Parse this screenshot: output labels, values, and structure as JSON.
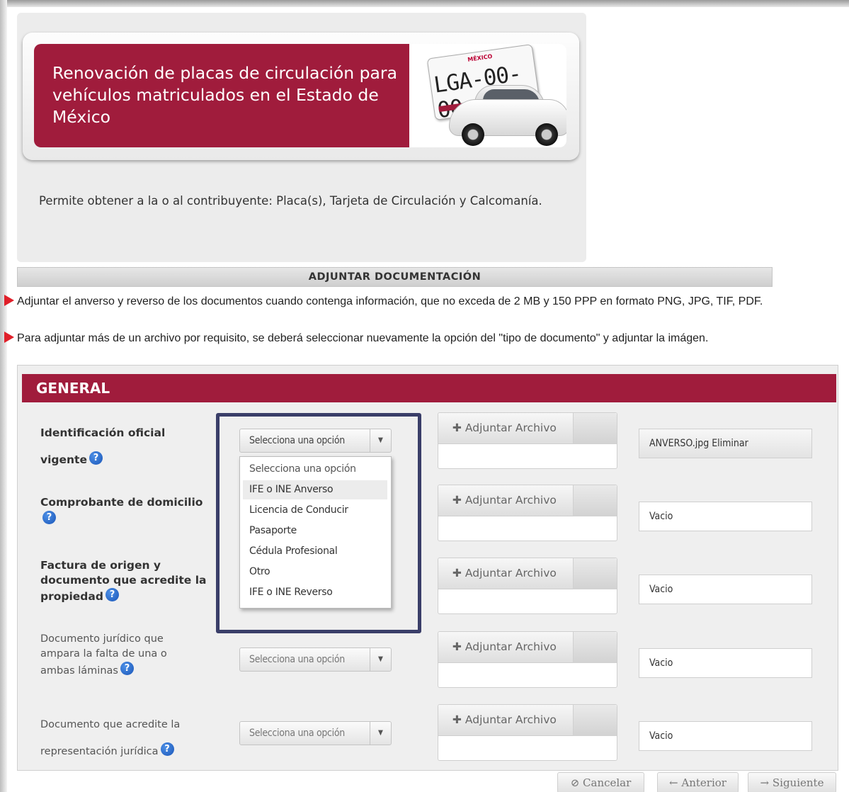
{
  "banner": {
    "title": "Renovación de placas de circulación para vehículos matriculados en el Estado de México",
    "plate_number": "LGA-00-00",
    "plate_brand": "MÉXICO"
  },
  "description": "Permite obtener a la o al contribuyente: Placa(s), Tarjeta de Circulación y Calcomanía.",
  "section_title": "ADJUNTAR DOCUMENTACIÓN",
  "notes": [
    "Adjuntar el anverso y reverso de los documentos cuando contenga información, que no exceda de 2 MB y 150 PPP en formato PNG, JPG, TIF, PDF.",
    "Para adjuntar más de un archivo por requisito, se deberá seleccionar nuevamente la opción del \"tipo de documento\" y adjuntar la imágen."
  ],
  "general": {
    "title": "GENERAL",
    "help_glyph": "?",
    "select_placeholder": "Selecciona una opción",
    "attach_label": "Adjuntar Archivo",
    "rows": [
      {
        "label": "Identificación oficial vigente",
        "file": "ANVERSO.jpg Eliminar"
      },
      {
        "label": "Comprobante de domicilio",
        "file": "Vacio"
      },
      {
        "label": "Factura de origen y documento que acredite la propiedad",
        "file": "Vacio"
      },
      {
        "label": "Documento jurídico que ampara la falta de una o ambas láminas",
        "file": "Vacio"
      },
      {
        "label": "Documento que acredite la representación jurídica",
        "file": "Vacio"
      }
    ],
    "dropdown_options": [
      "Selecciona una opción",
      "IFE o INE Anverso",
      "Licencia de Conducir",
      "Pasaporte",
      "Cédula Profesional",
      "Otro",
      "IFE o INE Reverso"
    ],
    "highlighted_option": "IFE o INE Anverso"
  },
  "footer": {
    "cancel": "⊘ Cancelar",
    "previous": "← Anterior",
    "next": "→ Siguiente"
  },
  "colors": {
    "brand": "#a01c3c",
    "highlight_frame": "#3a3e69",
    "bullet": "#e0202a",
    "help_icon": "#1a56b8"
  }
}
